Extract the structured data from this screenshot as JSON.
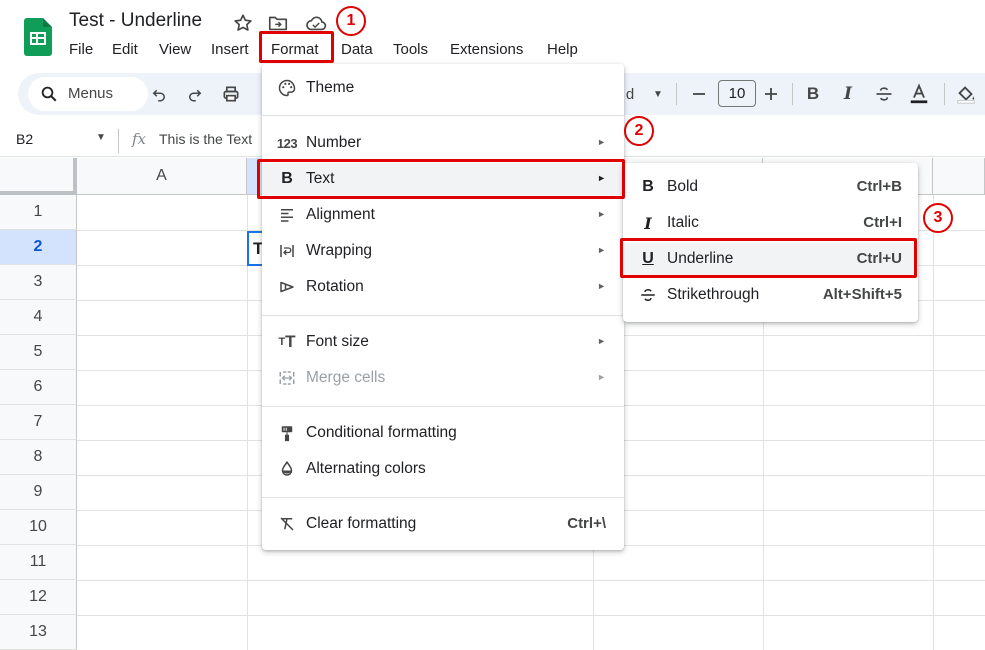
{
  "app": {
    "title": "Test - Underline"
  },
  "menubar": {
    "items": [
      "File",
      "Edit",
      "View",
      "Insert",
      "Format",
      "Data",
      "Tools",
      "Extensions",
      "Help"
    ]
  },
  "toolbar": {
    "search_label": "Menus",
    "font_fragment": "d",
    "font_size": "10"
  },
  "formula_bar": {
    "cell_ref": "B2",
    "fx": "fx",
    "content": "This is the Text"
  },
  "grid": {
    "columns": [
      "A",
      "",
      "",
      "",
      ""
    ],
    "rows": [
      "1",
      "2",
      "3",
      "4",
      "5",
      "6",
      "7",
      "8",
      "9",
      "10",
      "11",
      "12",
      "13"
    ],
    "selected_cell_text": "T"
  },
  "format_menu": {
    "items": [
      {
        "label": "Theme"
      },
      {
        "label": "Number"
      },
      {
        "label": "Text"
      },
      {
        "label": "Alignment"
      },
      {
        "label": "Wrapping"
      },
      {
        "label": "Rotation"
      },
      {
        "label": "Font size"
      },
      {
        "label": "Merge cells"
      },
      {
        "label": "Conditional formatting"
      },
      {
        "label": "Alternating colors"
      },
      {
        "label": "Clear formatting",
        "shortcut": "Ctrl+\\"
      }
    ]
  },
  "text_submenu": {
    "items": [
      {
        "label": "Bold",
        "shortcut": "Ctrl+B"
      },
      {
        "label": "Italic",
        "shortcut": "Ctrl+I"
      },
      {
        "label": "Underline",
        "shortcut": "Ctrl+U"
      },
      {
        "label": "Strikethrough",
        "shortcut": "Alt+Shift+5"
      }
    ]
  },
  "annotations": {
    "steps": [
      "1",
      "2",
      "3"
    ],
    "color": "#e00000"
  },
  "colors": {
    "accent": "#1a73e8",
    "sheets_green": "#0f9d58",
    "selected_header": "#d3e3fd"
  }
}
